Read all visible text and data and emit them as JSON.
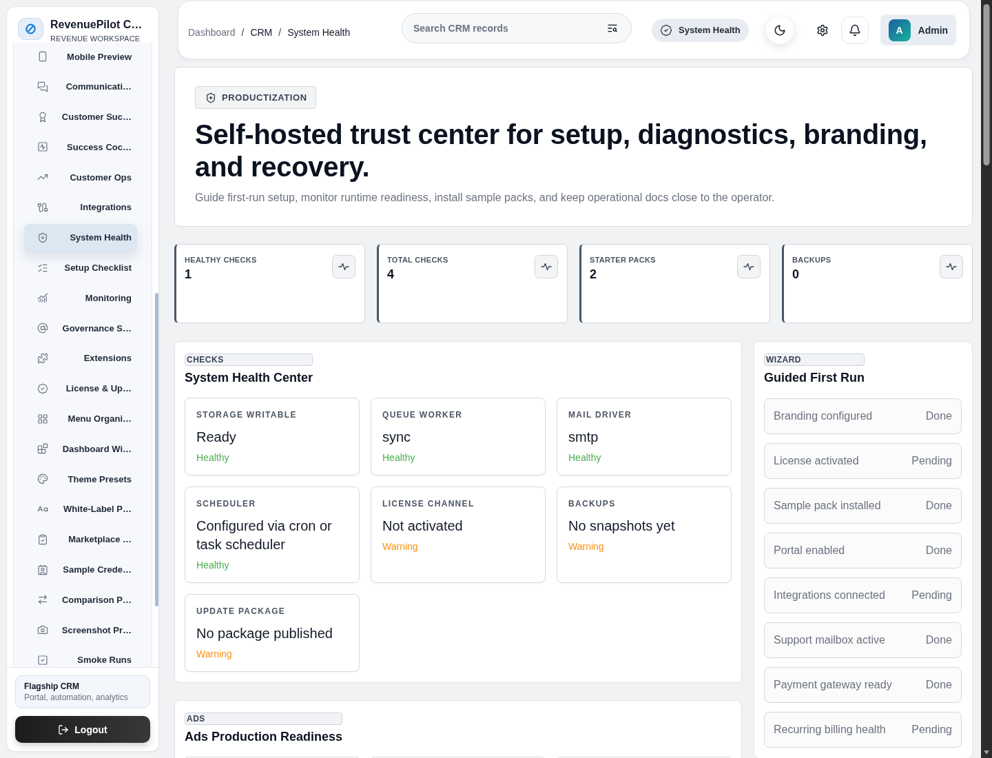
{
  "sidebar": {
    "brand": {
      "name": "RevenuePilot C…",
      "subtitle": "REVENUE WORKSPACE"
    },
    "items": [
      {
        "label": "Mobile Preview",
        "selected": false
      },
      {
        "label": "Communicati…",
        "selected": false
      },
      {
        "label": "Customer Suc…",
        "selected": false
      },
      {
        "label": "Success Coc…",
        "selected": false
      },
      {
        "label": "Customer Ops",
        "selected": false
      },
      {
        "label": "Integrations",
        "selected": false
      },
      {
        "label": "System Health",
        "selected": true
      },
      {
        "label": "Setup Checklist",
        "selected": false
      },
      {
        "label": "Monitoring",
        "selected": false
      },
      {
        "label": "Governance S…",
        "selected": false
      },
      {
        "label": "Extensions",
        "selected": false
      },
      {
        "label": "License & Up…",
        "selected": false
      },
      {
        "label": "Menu Organi…",
        "selected": false
      },
      {
        "label": "Dashboard Wi…",
        "selected": false
      },
      {
        "label": "Theme Presets",
        "selected": false
      },
      {
        "label": "White-Label P…",
        "selected": false
      },
      {
        "label": "Marketplace …",
        "selected": false
      },
      {
        "label": "Sample Crede…",
        "selected": false
      },
      {
        "label": "Comparison P…",
        "selected": false
      },
      {
        "label": "Screenshot Pr…",
        "selected": false
      },
      {
        "label": "Smoke Runs",
        "selected": false
      }
    ],
    "workspace": {
      "name": "Flagship CRM",
      "description": "Portal, automation, analytics"
    },
    "logout": "Logout"
  },
  "header": {
    "breadcrumb": [
      {
        "label": "Dashboard",
        "muted": true,
        "separator": "/"
      },
      {
        "label": "CRM",
        "muted": false,
        "separator": "/"
      },
      {
        "label": "System Health",
        "muted": false
      }
    ],
    "search": {
      "placeholder": "Search CRM records"
    },
    "status_chip": "System Health",
    "user": {
      "initial": "A",
      "name": "Admin"
    }
  },
  "hero": {
    "badge": "PRODUCTIZATION",
    "title": "Self-hosted trust center for setup, diagnostics, branding, and recovery.",
    "subtitle": "Guide first-run setup, monitor runtime readiness, install sample packs, and keep operational docs close to the operator."
  },
  "stats": [
    {
      "label": "HEALTHY CHECKS",
      "value": "1"
    },
    {
      "label": "TOTAL CHECKS",
      "value": "4"
    },
    {
      "label": "STARTER PACKS",
      "value": "2"
    },
    {
      "label": "BACKUPS",
      "value": "0"
    }
  ],
  "checks": {
    "tag": "CHECKS",
    "title": "System Health Center",
    "items": [
      {
        "label": "STORAGE WRITABLE",
        "value": "Ready",
        "status": "Healthy",
        "color": "#4caf50"
      },
      {
        "label": "QUEUE WORKER",
        "value": "sync",
        "status": "Healthy",
        "color": "#4caf50"
      },
      {
        "label": "MAIL DRIVER",
        "value": "smtp",
        "status": "Healthy",
        "color": "#4caf50"
      },
      {
        "label": "SCHEDULER",
        "value": "Configured via cron or task scheduler",
        "status": "Healthy",
        "color": "#4caf50"
      },
      {
        "label": "LICENSE CHANNEL",
        "value": "Not activated",
        "status": "Warning",
        "color": "#f7920f"
      },
      {
        "label": "BACKUPS",
        "value": "No snapshots yet",
        "status": "Warning",
        "color": "#f7920f"
      },
      {
        "label": "UPDATE PACKAGE",
        "value": "No package published",
        "status": "Warning",
        "color": "#f7920f"
      }
    ]
  },
  "ads": {
    "tag": "ADS",
    "title": "Ads Production Readiness"
  },
  "wizard": {
    "tag": "WIZARD",
    "title": "Guided First Run",
    "steps": [
      {
        "label": "Branding configured",
        "status": "Done"
      },
      {
        "label": "License activated",
        "status": "Pending"
      },
      {
        "label": "Sample pack installed",
        "status": "Done"
      },
      {
        "label": "Portal enabled",
        "status": "Done"
      },
      {
        "label": "Integrations connected",
        "status": "Pending"
      },
      {
        "label": "Support mailbox active",
        "status": "Done"
      },
      {
        "label": "Payment gateway ready",
        "status": "Done"
      },
      {
        "label": "Recurring billing health",
        "status": "Pending"
      }
    ]
  }
}
